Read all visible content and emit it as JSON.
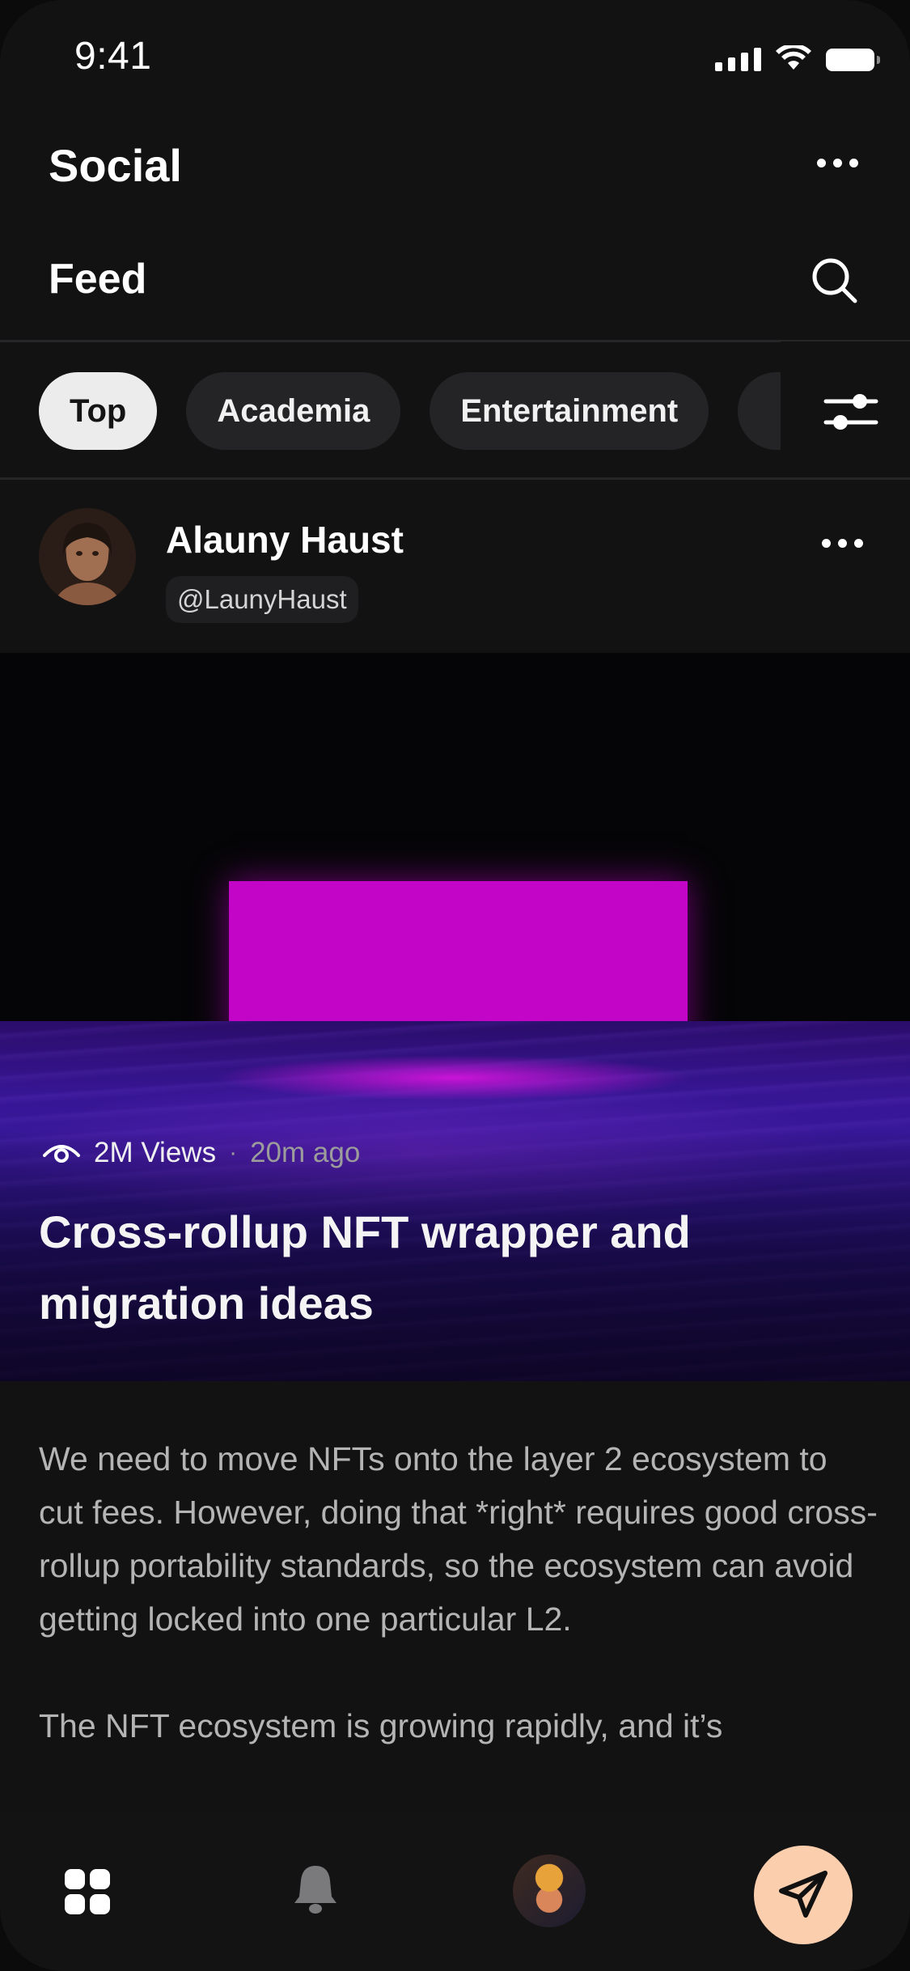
{
  "status_bar": {
    "time": "9:41"
  },
  "header": {
    "app_title": "Social",
    "section_title": "Feed"
  },
  "chips": [
    {
      "label": "Top",
      "active": true
    },
    {
      "label": "Academia",
      "active": false
    },
    {
      "label": "Entertainment",
      "active": false
    }
  ],
  "post": {
    "author_name": "Alauny Haust",
    "author_handle": "@LaunyHaust",
    "views": "2M Views",
    "separator": "·",
    "time_ago": "20m ago",
    "title": "Cross-rollup NFT wrapper and migration ideas",
    "body_paragraph_1": "We need to move NFTs onto the layer 2 ecosystem to cut fees. However, doing that *right* requires good cross-rollup portability standards, so the ecosystem can avoid getting locked into one particular L2.",
    "body_paragraph_2": "The NFT ecosystem is growing rapidly, and it’s"
  },
  "colors": {
    "background": "#121213",
    "active_chip": "#ececec",
    "send_button": "#fbcfae",
    "hero_accent": "#c305c7"
  },
  "icons": {
    "header_more": "more-horizontal-icon",
    "search": "search-icon",
    "filter": "sliders-icon",
    "views": "eye-icon",
    "nav_home": "grid-icon",
    "nav_notifications": "bell-icon",
    "nav_send": "send-icon"
  }
}
